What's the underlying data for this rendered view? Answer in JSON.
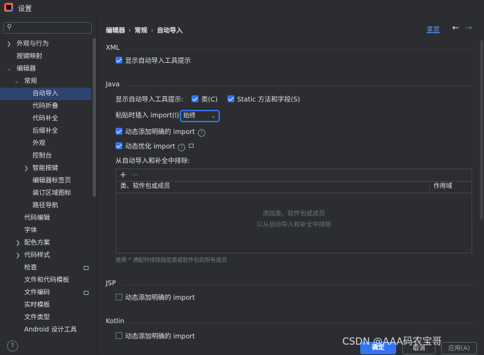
{
  "window": {
    "title": "设置"
  },
  "search": {
    "placeholder": "",
    "icon": "search-icon"
  },
  "sidebar": {
    "items": [
      {
        "label": "外观与行为"
      },
      {
        "label": "按键映射"
      },
      {
        "label": "编辑器"
      },
      {
        "label": "常规"
      },
      {
        "label": "自动导入"
      },
      {
        "label": "代码折叠"
      },
      {
        "label": "代码补全"
      },
      {
        "label": "后缀补全"
      },
      {
        "label": "外观"
      },
      {
        "label": "控制台"
      },
      {
        "label": "智能按键"
      },
      {
        "label": "编辑器标签页"
      },
      {
        "label": "装订区域图标"
      },
      {
        "label": "路径导航"
      },
      {
        "label": "代码编辑"
      },
      {
        "label": "字体"
      },
      {
        "label": "配色方案"
      },
      {
        "label": "代码样式"
      },
      {
        "label": "检查"
      },
      {
        "label": "文件和代码模板"
      },
      {
        "label": "文件编码"
      },
      {
        "label": "实时模板"
      },
      {
        "label": "文件类型"
      },
      {
        "label": "Android 设计工具"
      }
    ],
    "selected": "自动导入"
  },
  "header": {
    "breadcrumb": [
      "编辑器",
      "常规",
      "自动导入"
    ],
    "reset_label": "重置"
  },
  "xml": {
    "title": "XML",
    "show_popup": {
      "label": "显示自动导入工具提示",
      "checked": true
    }
  },
  "java": {
    "title": "Java",
    "show_popup_label": "显示自动导入工具提示:",
    "classes": {
      "label": "类(C)",
      "checked": true
    },
    "static": {
      "label": "Static 方法和字段(S)",
      "checked": true
    },
    "paste_label": "粘贴时插入 import(I):",
    "paste_value": "始终",
    "add_unambiguous": {
      "label": "动态添加明确的 import",
      "checked": true
    },
    "optimize": {
      "label": "动态优化 import",
      "checked": true
    },
    "exclude_title": "从自动导入和补全中排除:",
    "table_headers": [
      "类、软件包或成员",
      "作用域"
    ],
    "empty_line1": "添加类、软件包或成员",
    "empty_line2": "以从自动导入和补全中排除",
    "hint": "使用 * 通配符排除指定类或软件包的所有成员"
  },
  "jsp": {
    "title": "JSP",
    "add_unambiguous": {
      "label": "动态添加明确的 import",
      "checked": false
    }
  },
  "kotlin": {
    "title": "Kotlin",
    "add_unambiguous": {
      "label": "动态添加明确的 import",
      "checked": false
    }
  },
  "footer": {
    "ok": "确定",
    "cancel": "取消",
    "apply": "应用(A)",
    "help": "?"
  },
  "watermark": "CSDN @AAA码农宝哥",
  "colors": {
    "accent": "#3574f0",
    "link": "#548af7",
    "background": "#2b2d30",
    "selection": "#2e436e"
  }
}
